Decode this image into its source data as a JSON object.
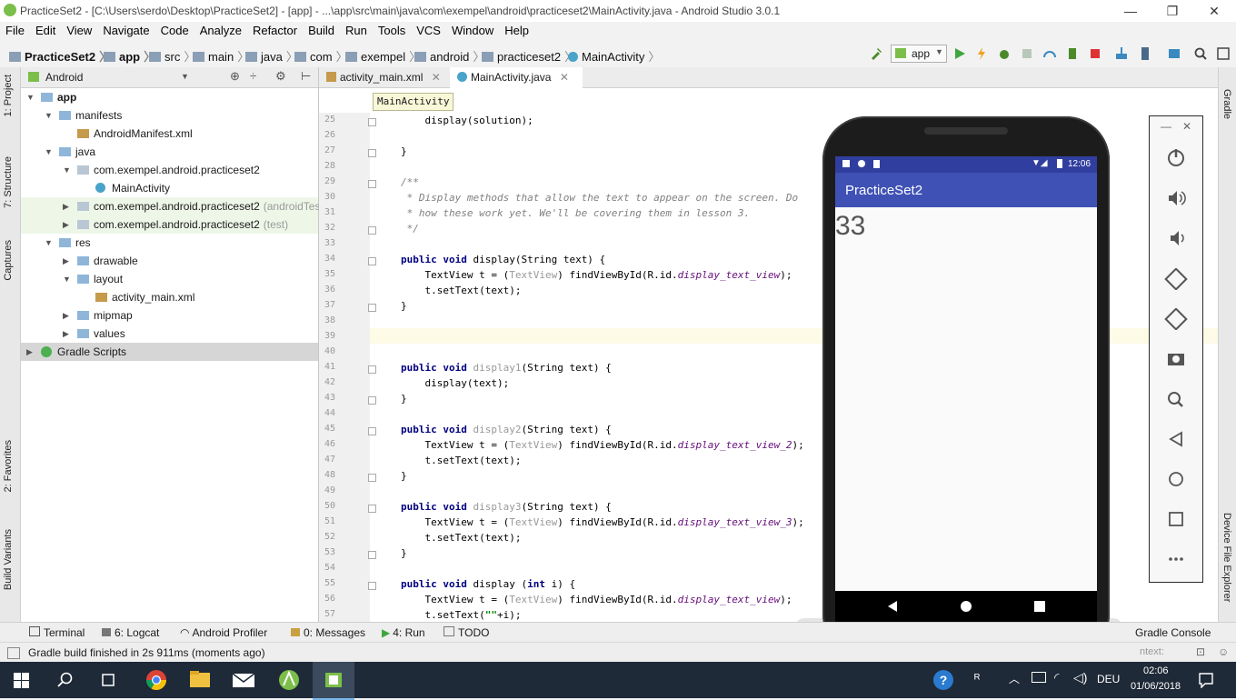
{
  "window": {
    "title": "PracticeSet2 - [C:\\Users\\serdo\\Desktop\\PracticeSet2] - [app] - ...\\app\\src\\main\\java\\com\\exempel\\android\\practiceset2\\MainActivity.java - Android Studio 3.0.1",
    "minimize": "—",
    "maximize": "❐",
    "close": "✕"
  },
  "menu": [
    "File",
    "Edit",
    "View",
    "Navigate",
    "Code",
    "Analyze",
    "Refactor",
    "Build",
    "Run",
    "Tools",
    "VCS",
    "Window",
    "Help"
  ],
  "breadcrumbs": [
    "PracticeSet2",
    "app",
    "src",
    "main",
    "java",
    "com",
    "exempel",
    "android",
    "practiceset2",
    "MainActivity"
  ],
  "toolbar": {
    "run_config": "app"
  },
  "left_tabs": [
    "1: Project",
    "7: Structure",
    "Captures",
    "2: Favorites",
    "Build Variants"
  ],
  "right_tabs": [
    "Gradle",
    "Device File Explorer"
  ],
  "project": {
    "view_selector": "Android",
    "tree": [
      {
        "label": "app",
        "depth": 0,
        "icon": "folder",
        "arrow": "▼",
        "bold": true
      },
      {
        "label": "manifests",
        "depth": 1,
        "icon": "folder",
        "arrow": "▼"
      },
      {
        "label": "AndroidManifest.xml",
        "depth": 2,
        "icon": "xml",
        "arrow": ""
      },
      {
        "label": "java",
        "depth": 1,
        "icon": "folder",
        "arrow": "▼"
      },
      {
        "label": "com.exempel.android.practiceset2",
        "depth": 2,
        "icon": "pkg",
        "arrow": "▼"
      },
      {
        "label": "MainActivity",
        "depth": 3,
        "icon": "class",
        "arrow": ""
      },
      {
        "label": "com.exempel.android.practiceset2",
        "suffix": "(androidTest)",
        "depth": 2,
        "icon": "pkg",
        "arrow": "▶",
        "hl": "green"
      },
      {
        "label": "com.exempel.android.practiceset2",
        "suffix": "(test)",
        "depth": 2,
        "icon": "pkg",
        "arrow": "▶",
        "hl": "green"
      },
      {
        "label": "res",
        "depth": 1,
        "icon": "folder",
        "arrow": "▼"
      },
      {
        "label": "drawable",
        "depth": 2,
        "icon": "folder",
        "arrow": "▶"
      },
      {
        "label": "layout",
        "depth": 2,
        "icon": "folder",
        "arrow": "▼"
      },
      {
        "label": "activity_main.xml",
        "depth": 3,
        "icon": "xml",
        "arrow": ""
      },
      {
        "label": "mipmap",
        "depth": 2,
        "icon": "folder",
        "arrow": "▶"
      },
      {
        "label": "values",
        "depth": 2,
        "icon": "folder",
        "arrow": "▶"
      },
      {
        "label": "Gradle Scripts",
        "depth": 0,
        "icon": "gradle",
        "arrow": "▶",
        "hl": "sel"
      }
    ]
  },
  "editor": {
    "tabs": [
      {
        "label": "activity_main.xml",
        "active": false
      },
      {
        "label": "MainActivity.java",
        "active": true
      }
    ],
    "breadcrumb_popup": "MainActivity",
    "lines": [
      {
        "n": "25",
        "html": "    display(solution);"
      },
      {
        "n": "26",
        "html": ""
      },
      {
        "n": "27",
        "html": "}"
      },
      {
        "n": "28",
        "html": ""
      },
      {
        "n": "29",
        "html": "<span class=\"cm\">/**</span>"
      },
      {
        "n": "30",
        "html": "<span class=\"cm\"> * Display methods that allow the text to appear on the screen. Do</span>"
      },
      {
        "n": "31",
        "html": "<span class=\"cm\"> * how these work yet. We'll be covering them in lesson 3.</span>"
      },
      {
        "n": "32",
        "html": "<span class=\"cm\"> */</span>"
      },
      {
        "n": "33",
        "html": ""
      },
      {
        "n": "34",
        "html": "<span class=\"kw\">public void</span> display(String text) {"
      },
      {
        "n": "35",
        "html": "    TextView t = (<span class=\"gr\">TextView</span>) findViewById(R.id.<span class=\"fld\">display_text_view</span>);"
      },
      {
        "n": "36",
        "html": "    t.setText(text);"
      },
      {
        "n": "37",
        "html": "}"
      },
      {
        "n": "38",
        "html": ""
      },
      {
        "n": "39",
        "html": ""
      },
      {
        "n": "40",
        "html": ""
      },
      {
        "n": "41",
        "html": "<span class=\"kw\">public void</span> <span class=\"gr\">display1</span>(String text) {"
      },
      {
        "n": "42",
        "html": "    display(text);"
      },
      {
        "n": "43",
        "html": "}"
      },
      {
        "n": "44",
        "html": ""
      },
      {
        "n": "45",
        "html": "<span class=\"kw\">public void</span> <span class=\"gr\">display2</span>(String text) {"
      },
      {
        "n": "46",
        "html": "    TextView t = (<span class=\"gr\">TextView</span>) findViewById(R.id.<span class=\"fld\">display_text_view_2</span>);"
      },
      {
        "n": "47",
        "html": "    t.setText(text);"
      },
      {
        "n": "48",
        "html": "}"
      },
      {
        "n": "49",
        "html": ""
      },
      {
        "n": "50",
        "html": "<span class=\"kw\">public void</span> <span class=\"gr\">display3</span>(String text) {"
      },
      {
        "n": "51",
        "html": "    TextView t = (<span class=\"gr\">TextView</span>) findViewById(R.id.<span class=\"fld\">display_text_view_3</span>);"
      },
      {
        "n": "52",
        "html": "    t.setText(text);"
      },
      {
        "n": "53",
        "html": "}"
      },
      {
        "n": "54",
        "html": ""
      },
      {
        "n": "55",
        "html": "<span class=\"kw\">public void</span> display (<span class=\"kw\">int</span> i) {"
      },
      {
        "n": "56",
        "html": "    TextView t = (<span class=\"gr\">TextView</span>) findViewById(R.id.<span class=\"fld\">display_text_view</span>);"
      },
      {
        "n": "57",
        "html": "    t.setText(<span class=\"str\">\"\"</span>+i);"
      }
    ]
  },
  "emulator": {
    "time": "12:06",
    "app_title": "PracticeSet2",
    "display_value": "33",
    "side_controls": [
      "power-icon",
      "volume-up-icon",
      "volume-down-icon",
      "rotate-left-icon",
      "rotate-right-icon",
      "camera-icon",
      "zoom-icon",
      "back-icon",
      "home-icon",
      "overview-icon",
      "more-icon"
    ]
  },
  "bottom_tabs": [
    {
      "label": "Terminal"
    },
    {
      "label": "6: Logcat"
    },
    {
      "label": "Android Profiler"
    },
    {
      "label": "0: Messages"
    },
    {
      "label": "4: Run"
    },
    {
      "label": "TODO"
    },
    {
      "label": "Gradle Console"
    }
  ],
  "status": {
    "message": "Gradle build finished in 2s 911ms (moments ago)",
    "context": "ntext:"
  },
  "taskbar": {
    "language": "DEU",
    "time": "02:06",
    "date": "01/06/2018"
  },
  "colors": {
    "app_bar": "#3f51b5",
    "status_bar": "#303f9f",
    "keyword": "#000080",
    "comment": "#808080"
  }
}
